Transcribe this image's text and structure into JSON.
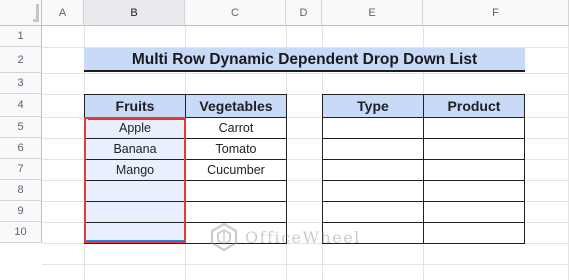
{
  "columns": [
    "A",
    "B",
    "C",
    "D",
    "E",
    "F"
  ],
  "rows": [
    "1",
    "2",
    "3",
    "4",
    "5",
    "6",
    "7",
    "8",
    "9",
    "10"
  ],
  "title": "Multi Row Dynamic Dependent Drop Down List",
  "left_table": {
    "headers": [
      "Fruits",
      "Vegetables"
    ],
    "rows": [
      [
        "Apple",
        "Carrot"
      ],
      [
        "Banana",
        "Tomato"
      ],
      [
        "Mango",
        "Cucumber"
      ],
      [
        "",
        ""
      ],
      [
        "",
        ""
      ],
      [
        "",
        ""
      ]
    ]
  },
  "right_table": {
    "headers": [
      "Type",
      "Product"
    ],
    "rows": [
      [
        "",
        ""
      ],
      [
        "",
        ""
      ],
      [
        "",
        ""
      ],
      [
        "",
        ""
      ],
      [
        "",
        ""
      ],
      [
        "",
        ""
      ]
    ]
  },
  "watermark": "OfficeWheel",
  "colors": {
    "header_fill": "#c9daf8",
    "selection": "#1a73e8",
    "highlight_border": "#e53935"
  }
}
